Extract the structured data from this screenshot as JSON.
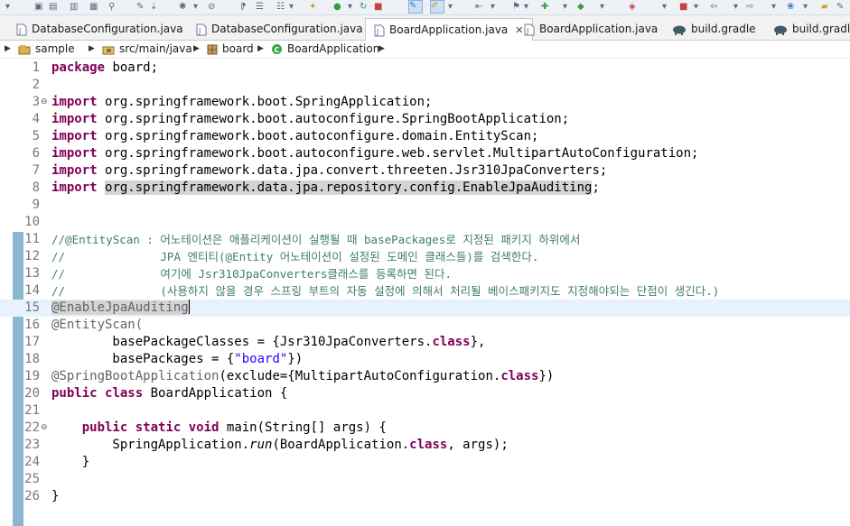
{
  "tabs": [
    {
      "label": "DatabaseConfiguration.java",
      "icon": "java-file-icon",
      "active": false
    },
    {
      "label": "DatabaseConfiguration.java",
      "icon": "java-file-icon",
      "active": false
    },
    {
      "label": "BoardApplication.java",
      "icon": "java-file-icon",
      "active": true
    },
    {
      "label": "BoardApplication.java",
      "icon": "java-file-icon",
      "active": false
    },
    {
      "label": "build.gradle",
      "icon": "gradle-elephant-icon",
      "active": false
    },
    {
      "label": "build.gradle",
      "icon": "gradle-elephant-icon",
      "active": false
    }
  ],
  "breadcrumb": [
    {
      "label": "sample",
      "icon": "project-icon"
    },
    {
      "label": "src/main/java",
      "icon": "source-folder-icon"
    },
    {
      "label": "board",
      "icon": "package-icon"
    },
    {
      "label": "BoardApplication",
      "icon": "class-icon"
    }
  ],
  "colors": {
    "keyword": "#7f0055",
    "comment": "#3f7f5f",
    "string": "#2a00ff",
    "annotation": "#646464",
    "current_line": "#e8f2fe"
  },
  "code": {
    "l1_kw": "package",
    "l1_rest": " board;",
    "import_kw": "import",
    "l3_rest": " org.springframework.boot.SpringApplication;",
    "l4_rest": " org.springframework.boot.autoconfigure.SpringBootApplication;",
    "l5_rest": " org.springframework.boot.autoconfigure.domain.EntityScan;",
    "l6_rest": " org.springframework.boot.autoconfigure.web.servlet.MultipartAutoConfiguration;",
    "l7_rest": " org.springframework.data.jpa.convert.threeten.Jsr310JpaConverters;",
    "l8_hl": "org.springframework.data.jpa.repository.config.EnableJpaAuditing",
    "l8_semi": ";",
    "l11": "//@EntityScan : 어노테이션은 애플리케이션이 실행될 때 basePackages로 지정된 패키지 하위에서",
    "l12": "//              JPA 엔티티(@Entity 어노테이션이 설정된 도메인 클래스들)를 검색한다.",
    "l13": "//              여기에 Jsr310JpaConverters클래스를 등록하면 된다.",
    "l14": "//              (사용하지 않을 경우 스프링 부트의 자동 설정에 의해서 처리될 베이스패키지도 지정해야되는 단점이 생긴다.)",
    "l15": "@EnableJpaAuditing",
    "l16": "@EntityScan(",
    "l17_a": "        basePackageClasses = {Jsr310JpaConverters.",
    "class_kw": "class",
    "l17_b": "},",
    "l18_a": "        basePackages = {",
    "l18_str": "\"board\"",
    "l18_b": "})",
    "l19_ann": "@SpringBootApplication",
    "l19_a": "(exclude={MultipartAutoConfiguration.",
    "l19_b": "})",
    "public_kw": "public",
    "l20_rest": " BoardApplication {",
    "static_kw": "static",
    "void_kw": "void",
    "l22_rest": " main(String[] args) {",
    "l23_a": "        SpringApplication.",
    "l23_run": "run",
    "l23_b": "(BoardApplication.",
    "l23_c": ", args);",
    "l24": "    }",
    "l26": "}"
  }
}
